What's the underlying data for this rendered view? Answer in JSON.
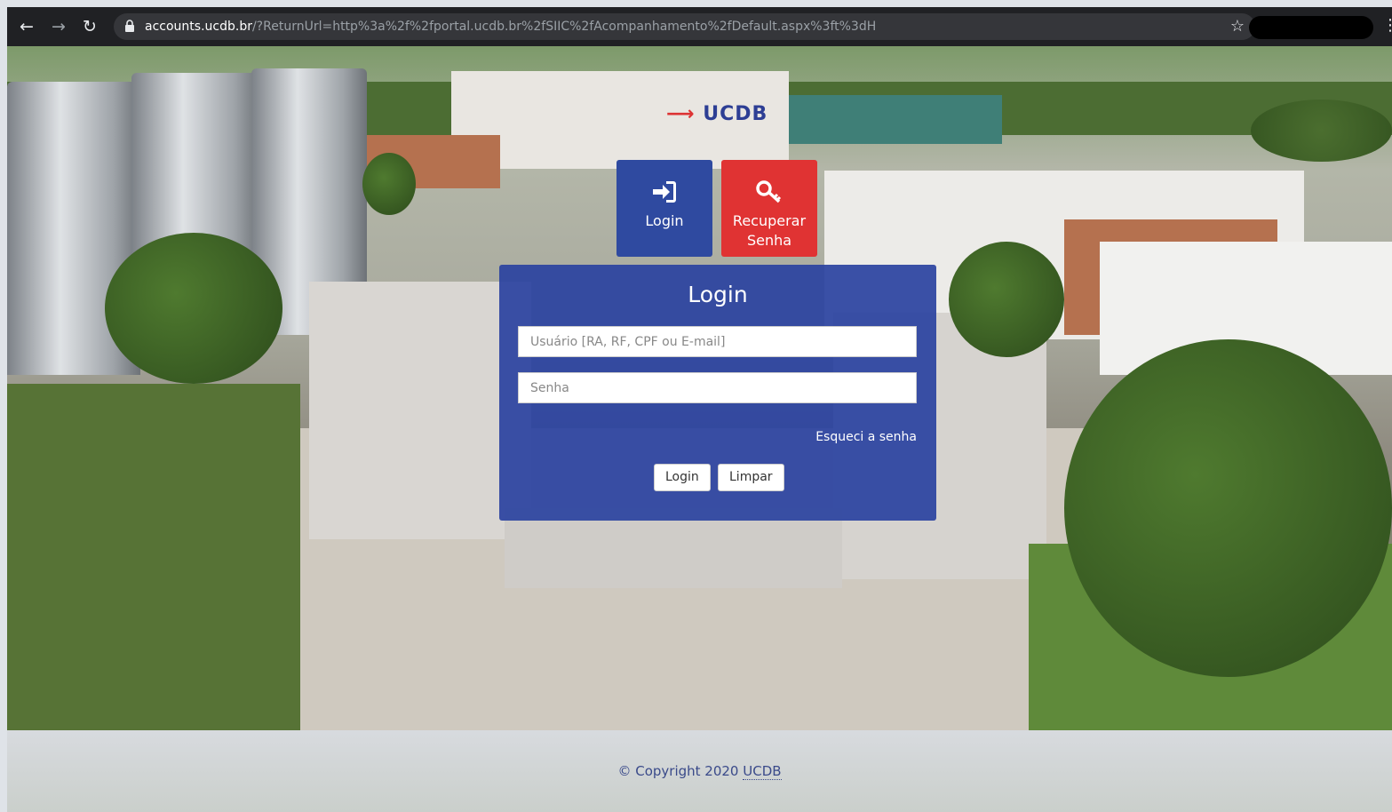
{
  "browser": {
    "back_icon": "arrow-left-icon",
    "forward_icon": "arrow-right-icon",
    "reload_icon": "reload-icon",
    "url_host": "accounts.ucdb.br",
    "url_path": "/?ReturnUrl=http%3a%2f%2fportal.ucdb.br%2fSIIC%2fAcompanhamento%2fDefault.aspx%3ft%3dH",
    "bookmark_icon": "star-icon"
  },
  "header": {
    "logo_text": "UCDB"
  },
  "tiles": {
    "login_label": "Login",
    "recover_label": "Recuperar Senha"
  },
  "login_form": {
    "title": "Login",
    "username_placeholder": "Usuário [RA, RF, CPF ou E-mail]",
    "username_value": "",
    "password_placeholder": "Senha",
    "password_value": "",
    "forgot_link": "Esqueci a senha",
    "login_button": "Login",
    "clear_button": "Limpar"
  },
  "footer": {
    "copyright_prefix": "© Copyright 2020",
    "copyright_brand": "UCDB"
  },
  "colors": {
    "panel_blue": "#2c44a0",
    "tile_login_blue": "#2f4aa0",
    "tile_recover_red": "#e03333"
  }
}
